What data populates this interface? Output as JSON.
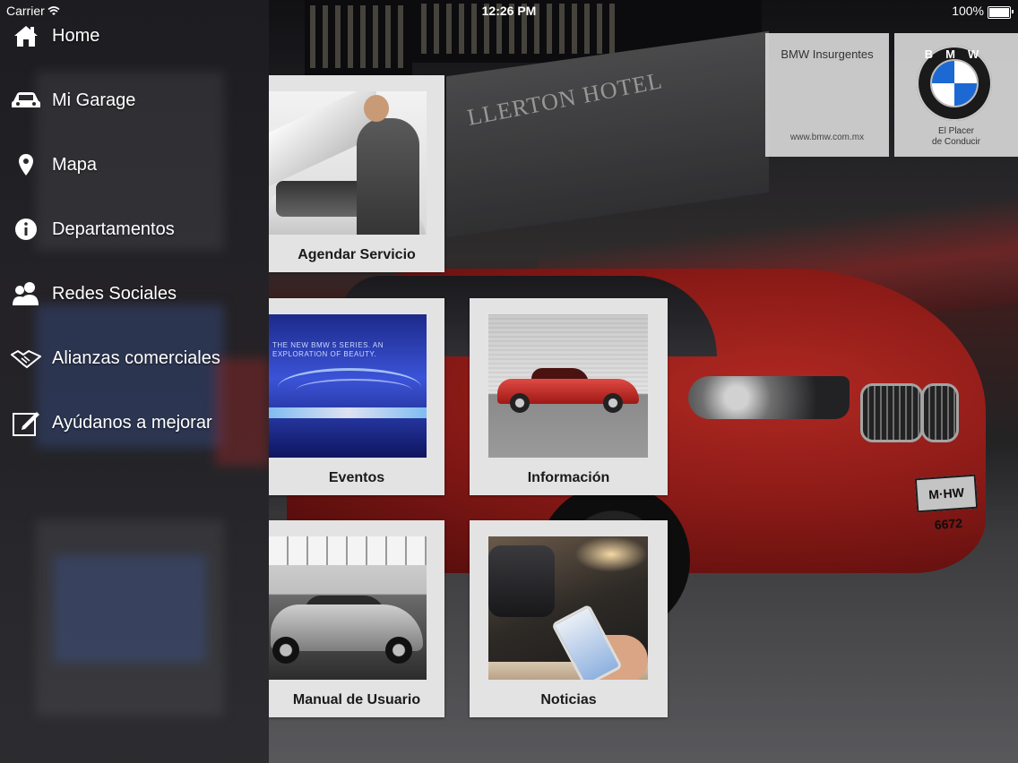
{
  "status_bar": {
    "carrier": "Carrier",
    "time": "12:26 PM",
    "battery": "100%"
  },
  "menu": {
    "items": [
      {
        "label": "Home",
        "icon": "home-icon"
      },
      {
        "label": "Mi Garage",
        "icon": "car-icon"
      },
      {
        "label": "Mapa",
        "icon": "map-pin-icon"
      },
      {
        "label": "Departamentos",
        "icon": "info-icon"
      },
      {
        "label": "Redes Sociales",
        "icon": "people-icon"
      },
      {
        "label": "Alianzas comerciales",
        "icon": "handshake-icon"
      },
      {
        "label": "Ayúdanos a mejorar",
        "icon": "edit-icon"
      }
    ]
  },
  "tiles": {
    "agendar": {
      "label": "Agendar Servicio"
    },
    "eventos": {
      "label": "Eventos",
      "image_text": "THE NEW BMW 5 SERIES. AN EXPLORATION OF BEAUTY."
    },
    "informacion": {
      "label": "Información"
    },
    "manual": {
      "label": "Manual de Usuario"
    },
    "noticias": {
      "label": "Noticias"
    }
  },
  "dealer": {
    "name": "BMW Insurgentes",
    "url": "www.bmw.com.mx",
    "logo_letters": "BMW",
    "slogan_line1": "El Placer",
    "slogan_line2": "de Conducir"
  },
  "background": {
    "hotel_sign": "LLERTON HOTEL",
    "license_plate": "M·HW 6672"
  },
  "colors": {
    "bmw_blue": "#1c69d4",
    "car_red": "#c0221c",
    "tile_bg": "#e3e3e3"
  }
}
